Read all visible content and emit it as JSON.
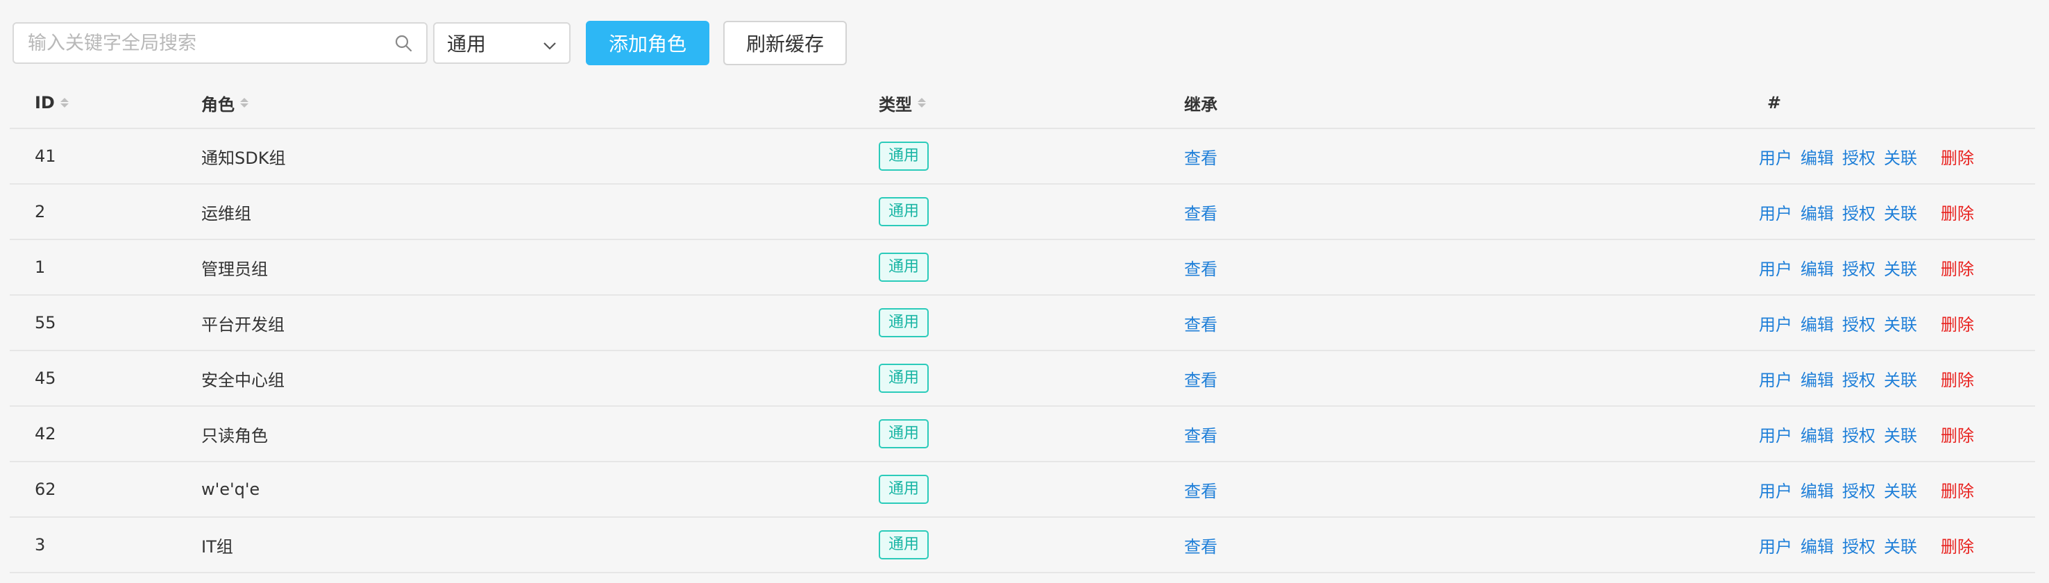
{
  "toolbar": {
    "search_placeholder": "输入关键字全局搜索",
    "select_value": "通用",
    "add_button": "添加角色",
    "refresh_button": "刷新缓存"
  },
  "table": {
    "headers": {
      "id": "ID",
      "role": "角色",
      "type": "类型",
      "inherit": "继承",
      "actions": "#"
    },
    "rows": [
      {
        "id": "41",
        "role": "通知SDK组",
        "type": "通用",
        "inherit": "查看"
      },
      {
        "id": "2",
        "role": "运维组",
        "type": "通用",
        "inherit": "查看"
      },
      {
        "id": "1",
        "role": "管理员组",
        "type": "通用",
        "inherit": "查看"
      },
      {
        "id": "55",
        "role": "平台开发组",
        "type": "通用",
        "inherit": "查看"
      },
      {
        "id": "45",
        "role": "安全中心组",
        "type": "通用",
        "inherit": "查看"
      },
      {
        "id": "42",
        "role": "只读角色",
        "type": "通用",
        "inherit": "查看"
      },
      {
        "id": "62",
        "role": "w'e'q'e",
        "type": "通用",
        "inherit": "查看"
      },
      {
        "id": "3",
        "role": "IT组",
        "type": "通用",
        "inherit": "查看"
      }
    ],
    "action_labels": {
      "user": "用户",
      "edit": "编辑",
      "grant": "授权",
      "link": "关联",
      "delete": "删除"
    }
  },
  "colors": {
    "primary": "#2db7f5",
    "link": "#1f7fd8",
    "danger": "#e8221f",
    "tag_border": "#2bcbba"
  },
  "icons": {
    "search": "search-icon",
    "dropdown": "chevron-down-icon",
    "sort": "sort-icon"
  }
}
